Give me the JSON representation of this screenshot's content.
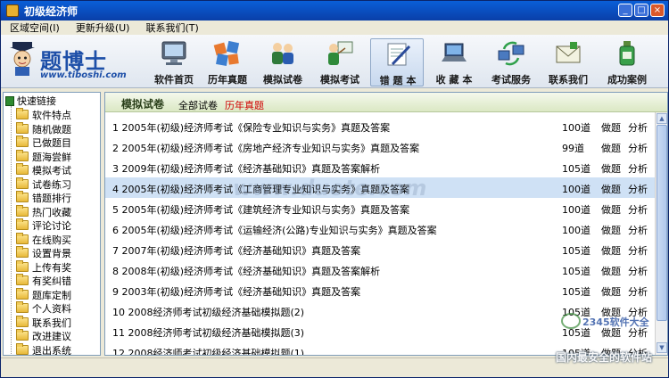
{
  "window": {
    "title": "初级经济师"
  },
  "menu": [
    "区域空间(I)",
    "更新升级(U)",
    "联系我们(T)"
  ],
  "logo": {
    "name": "题博士",
    "url": "www.tiboshi.com"
  },
  "toolbar": [
    {
      "label": "软件首页",
      "icon": "monitor-icon"
    },
    {
      "label": "历年真题",
      "icon": "puzzle-icon"
    },
    {
      "label": "模拟试卷",
      "icon": "people-icon"
    },
    {
      "label": "模拟考试",
      "icon": "teacher-icon"
    },
    {
      "label": "错 题 本",
      "icon": "notebook-icon",
      "active": true
    },
    {
      "label": "收 藏 本",
      "icon": "laptop-icon"
    },
    {
      "label": "考试服务",
      "icon": "network-icon"
    },
    {
      "label": "联系我们",
      "icon": "envelope-icon"
    },
    {
      "label": "成功案例",
      "icon": "bottle-icon"
    }
  ],
  "sidebar": {
    "root": "快速链接",
    "items": [
      "软件特点",
      "随机做题",
      "已做题目",
      "题海尝鲜",
      "模拟考试",
      "试卷练习",
      "错题排行",
      "热门收藏",
      "评论讨论",
      "在线购买",
      "设置背景",
      "上传有奖",
      "有奖纠错",
      "题库定制",
      "个人资料",
      "联系我们",
      "改进建议",
      "退出系统"
    ]
  },
  "main": {
    "title": "模拟试卷",
    "tab_all": "全部试卷",
    "tab_history": "历年真题",
    "do_label": "做题",
    "analyze_label": "分析",
    "rows": [
      {
        "text": "1 2005年(初级)经济师考试《保险专业知识与实务》真题及答案",
        "count": "100道"
      },
      {
        "text": "2 2005年(初级)经济师考试《房地产经济专业知识与实务》真题及答案",
        "count": "99道"
      },
      {
        "text": "3 2009年(初级)经济师考试《经济基础知识》真题及答案解析",
        "count": "105道"
      },
      {
        "text": "4 2005年(初级)经济师考试《工商管理专业知识与实务》真题及答案",
        "count": "100道",
        "selected": true
      },
      {
        "text": "5 2005年(初级)经济师考试《建筑经济专业知识与实务》真题及答案",
        "count": "100道"
      },
      {
        "text": "6 2005年(初级)经济师考试《运输经济(公路)专业知识与实务》真题及答案",
        "count": "100道"
      },
      {
        "text": "7 2007年(初级)经济师考试《经济基础知识》真题及答案",
        "count": "105道"
      },
      {
        "text": "8 2008年(初级)经济师考试《经济基础知识》真题及答案解析",
        "count": "105道"
      },
      {
        "text": "9 2003年(初级)经济师考试《经济基础知识》真题及答案",
        "count": "105道"
      },
      {
        "text": "10 2008经济师考试初级经济基础模拟题(2)",
        "count": "105道"
      },
      {
        "text": "11 2008经济师考试初级经济基础模拟题(3)",
        "count": "105道"
      },
      {
        "text": "12 2008经济师考试初级经济基础模拟题(1)",
        "count": "105道"
      }
    ]
  },
  "watermarks": {
    "center": "www.duote.com",
    "brand": "2345软件大全",
    "slogan": "国内最安全的软件站"
  }
}
